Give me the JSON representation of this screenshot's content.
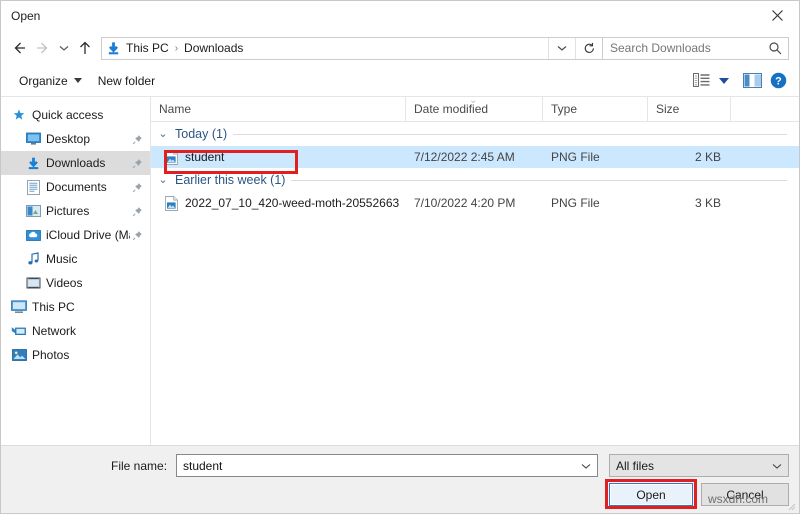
{
  "window": {
    "title": "Open",
    "close_label": "✕"
  },
  "navigation": {
    "back_tooltip": "Back",
    "forward_tooltip": "Forward",
    "recent_tooltip": "Recent locations",
    "up_tooltip": "Up",
    "breadcrumb": [
      "This PC",
      "Downloads"
    ],
    "separator": "›",
    "refresh_tooltip": "Refresh",
    "dropdown_tooltip": "Previous locations"
  },
  "search": {
    "placeholder": "Search Downloads",
    "value": ""
  },
  "toolbar": {
    "organize_label": "Organize",
    "new_folder_label": "New folder",
    "view_tooltip": "Change your view",
    "preview_tooltip": "Show the preview pane",
    "help_tooltip": "Get help"
  },
  "sidebar": {
    "items": [
      {
        "label": "Quick access",
        "icon": "pin-star-icon",
        "level": 1,
        "pinned": false,
        "selected": false
      },
      {
        "label": "Desktop",
        "icon": "desktop-icon",
        "level": 2,
        "pinned": true,
        "selected": false
      },
      {
        "label": "Downloads",
        "icon": "downloads-icon",
        "level": 2,
        "pinned": true,
        "selected": true
      },
      {
        "label": "Documents",
        "icon": "documents-icon",
        "level": 2,
        "pinned": true,
        "selected": false
      },
      {
        "label": "Pictures",
        "icon": "pictures-icon",
        "level": 2,
        "pinned": true,
        "selected": false
      },
      {
        "label": "iCloud Drive (Ma",
        "icon": "icloud-drive-icon",
        "level": 2,
        "pinned": true,
        "selected": false
      },
      {
        "label": "Music",
        "icon": "music-icon",
        "level": 2,
        "pinned": false,
        "selected": false
      },
      {
        "label": "Videos",
        "icon": "videos-icon",
        "level": 2,
        "pinned": false,
        "selected": false
      },
      {
        "label": "This PC",
        "icon": "this-pc-icon",
        "level": 1,
        "pinned": false,
        "selected": false
      },
      {
        "label": "Network",
        "icon": "network-icon",
        "level": 1,
        "pinned": false,
        "selected": false
      },
      {
        "label": "Photos",
        "icon": "photos-icon",
        "level": 1,
        "pinned": false,
        "selected": false
      }
    ]
  },
  "file_list": {
    "columns": [
      "Name",
      "Date modified",
      "Type",
      "Size"
    ],
    "groups": [
      {
        "title": "Today (1)",
        "chevron": "⌄",
        "rows": [
          {
            "name": "student",
            "date_modified": "7/12/2022 2:45 AM",
            "type": "PNG File",
            "size": "2 KB",
            "selected": true
          }
        ]
      },
      {
        "title": "Earlier this week (1)",
        "chevron": "⌄",
        "rows": [
          {
            "name": "2022_07_10_420-weed-moth-20552663",
            "date_modified": "7/10/2022 4:20 PM",
            "type": "PNG File",
            "size": "3 KB",
            "selected": false
          }
        ]
      }
    ]
  },
  "footer": {
    "file_name_label": "File name:",
    "file_name_value": "student",
    "file_name_placeholder": "File name:",
    "filter_value": "All files",
    "open_label": "Open",
    "cancel_label": "Cancel"
  },
  "annotations": {
    "color": "#e02020",
    "targets": [
      "student-file-row-name",
      "open-button"
    ]
  },
  "watermark": {
    "text": "wsxdn.com"
  },
  "colors": {
    "selection_blue": "#cce8ff",
    "group_header_blue": "#2b5584",
    "annotation_red": "#e02020",
    "focus_blue": "#3b76c6"
  }
}
